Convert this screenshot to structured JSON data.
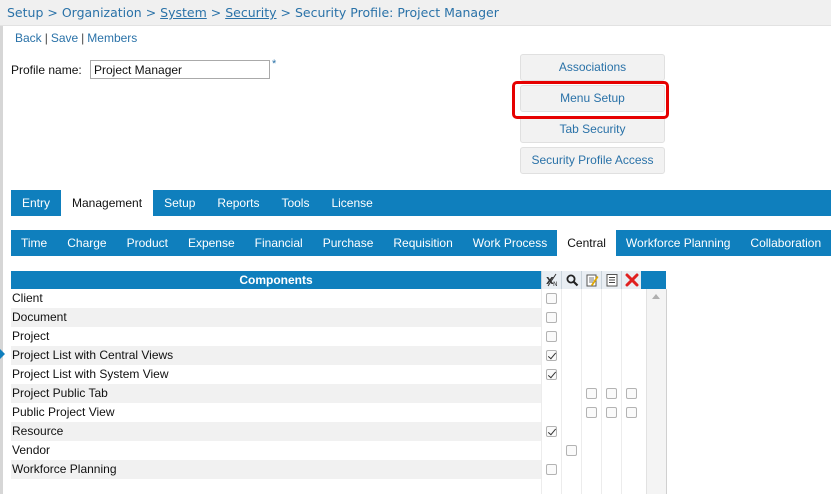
{
  "breadcrumb": {
    "setup": "Setup",
    "sep1": " > ",
    "organization": "Organization",
    "sep2": " > ",
    "system": "System",
    "sep3": " > ",
    "security": "Security",
    "sep4": " > ",
    "current": "Security Profile: Project Manager"
  },
  "toolbar": {
    "back": "Back",
    "save": "Save",
    "members": "Members",
    "separator": "|"
  },
  "profile": {
    "label": "Profile name:",
    "value": "Project Manager",
    "required_marker": "*"
  },
  "side_buttons": {
    "associations": "Associations",
    "menu_setup": "Menu Setup",
    "tab_security": "Tab Security",
    "security_profile_access": "Security Profile Access"
  },
  "main_tabs": [
    "Entry",
    "Management",
    "Setup",
    "Reports",
    "Tools",
    "License"
  ],
  "main_tabs_active": "Management",
  "sub_tabs": [
    "Time",
    "Charge",
    "Product",
    "Expense",
    "Financial",
    "Purchase",
    "Requisition",
    "Work Process",
    "Central",
    "Workforce Planning",
    "Collaboration"
  ],
  "sub_tabs_active": "Central",
  "grid": {
    "header": "Components",
    "icon_columns": [
      "all-none-icon",
      "view-icon",
      "edit-icon",
      "list-icon",
      "delete-icon"
    ],
    "rows": [
      {
        "name": "Client",
        "checks": [
          "off",
          null,
          null,
          null,
          null
        ]
      },
      {
        "name": "Document",
        "checks": [
          "off",
          null,
          null,
          null,
          null
        ]
      },
      {
        "name": "Project",
        "checks": [
          "off",
          null,
          null,
          null,
          null
        ]
      },
      {
        "name": "Project List with Central Views",
        "checks": [
          "on",
          null,
          null,
          null,
          null
        ]
      },
      {
        "name": "Project List with System View",
        "checks": [
          "on",
          null,
          null,
          null,
          null
        ]
      },
      {
        "name": "Project Public Tab",
        "checks": [
          null,
          null,
          "off",
          "off",
          "off"
        ]
      },
      {
        "name": "Public Project View",
        "checks": [
          null,
          null,
          "off",
          "off",
          "off"
        ]
      },
      {
        "name": "Resource",
        "checks": [
          "on",
          null,
          null,
          null,
          null
        ]
      },
      {
        "name": "Vendor",
        "checks": [
          null,
          "off",
          null,
          null,
          null
        ]
      },
      {
        "name": "Workforce Planning",
        "checks": [
          "off",
          null,
          null,
          null,
          null
        ]
      }
    ]
  },
  "colors": {
    "accent": "#0f7fbd",
    "link": "#2a72a8",
    "highlight": "#e60000"
  }
}
